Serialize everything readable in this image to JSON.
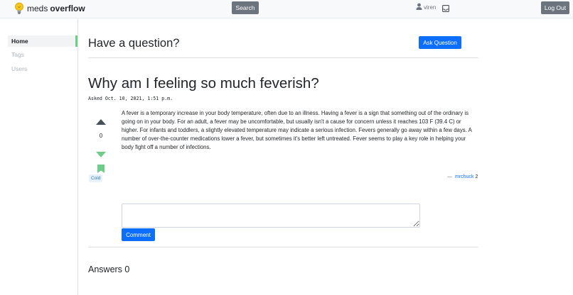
{
  "nav": {
    "brand_light": "meds",
    "brand_bold": "overflow",
    "search_label": "Search",
    "username": "viren",
    "logout_label": "Log Out"
  },
  "sidebar": {
    "items": [
      {
        "label": "Home",
        "active": true
      },
      {
        "label": "Tags",
        "active": false
      },
      {
        "label": "Users",
        "active": false
      }
    ]
  },
  "main": {
    "prompt": "Have a question?",
    "ask_label": "Ask Question"
  },
  "question": {
    "title": "Why am I feeling so much feverish?",
    "asked": "Asked Oct. 10, 2021, 1:51 p.m.",
    "votes": "0",
    "tag": "Cold",
    "body": "A fever is a temporary increase in your body temperature, often due to an illness. Having a fever is a sign that something out of the ordinary is going on in your body. For an adult, a fever may be uncomfortable, but usually isn't a cause for concern unless it reaches 103 F (39.4 C) or higher. For infants and toddlers, a slightly elevated temperature may indicate a serious infection. Fevers generally go away within a few days. A number of over-the-counter medications lower a fever, but sometimes it's better left untreated. Fever seems to play a key role in helping your body fight off a number of infections.",
    "author_dash": "—",
    "author": "mrchuck",
    "author_rep": "2"
  },
  "comment": {
    "value": "",
    "button_label": "Comment"
  },
  "answers": {
    "heading": "Answers 0"
  },
  "colors": {
    "primary": "#0d6efd",
    "secondary": "#6c757d",
    "vote_green": "#6dce8a",
    "bulb_yellow": "#f7c51e"
  }
}
